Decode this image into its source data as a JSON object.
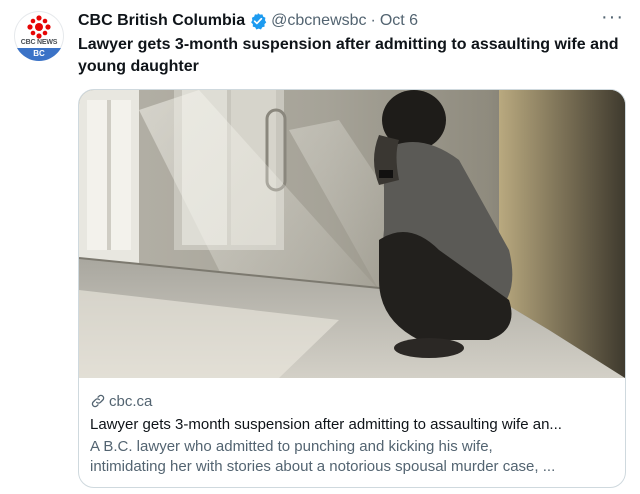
{
  "account": {
    "display_name": "CBC British Columbia",
    "handle": "@cbcnewsbc",
    "date": "Oct 6",
    "separator": "·",
    "avatar_wordmark": "CBC NEWS",
    "avatar_region": "BC",
    "verified": true
  },
  "tweet": {
    "text": "Lawyer gets 3-month suspension after admitting to assaulting wife and young daughter"
  },
  "card": {
    "domain": "cbc.ca",
    "title": "Lawyer gets 3-month suspension after admitting to assaulting wife an...",
    "description_line1": "A B.C. lawyer who admitted to punching and kicking his wife,",
    "description_line2": "intimidating her with stories about a notorious spousal murder case, ..."
  },
  "icons": {
    "verified": "verified-badge-icon",
    "more": "more-options-icon",
    "link": "link-icon",
    "avatar_logo": "cbc-gem-logo"
  },
  "colors": {
    "verified": "#1d9bf0",
    "secondary_text": "#536471",
    "region_badge": "#3b73c7",
    "cbc_red": "#e60505",
    "card_border": "#cfd9de"
  }
}
